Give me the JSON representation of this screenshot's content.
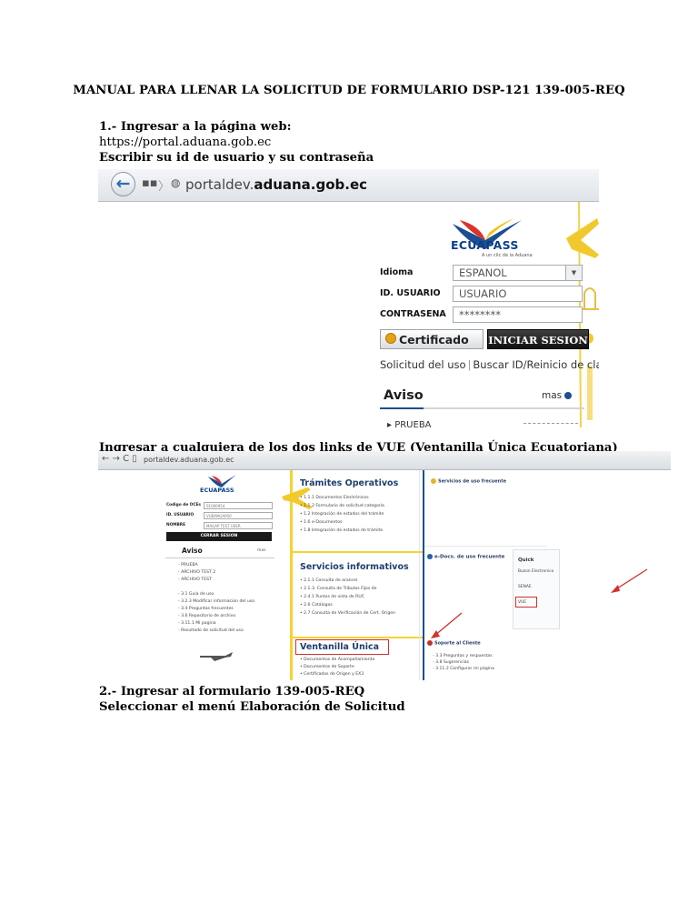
{
  "document": {
    "title": "MANUAL PARA LLENAR LA SOLICITUD DE FORMULARIO DSP-121 139-005-REQ",
    "step1_heading": "1.- Ingresar a la página web:",
    "step1_url": "https://portal.aduana.gob.ec",
    "step1_instruction": "Escribir su id de usuario y su contraseña",
    "vue_instruction": "Ingresar a cualquiera de los dos links de VUE (Ventanilla Única Ecuatoriana)",
    "step2_heading": "2.- Ingresar al formulario 139-005-REQ",
    "step2_instruction": "Seleccionar el menú Elaboración de Solicitud"
  },
  "login_screenshot": {
    "address_prefix": "portaldev.",
    "address_domain": "aduana.gob.ec",
    "logo_text": "ECUAPASS",
    "logo_tagline": "A un clic de la Aduana",
    "idioma_label": "Idioma",
    "idioma_value": "ESPANOL",
    "usuario_label": "ID. USUARIO",
    "usuario_value": "USUARIO",
    "contrasena_label": "CONTRASENA",
    "contrasena_value": "********",
    "certificado_button": "Certificado",
    "login_button": "INICIAR SESION",
    "link_solicitud": "Solicitud del uso",
    "link_buscar": "Buscar ID/Reinicio de clave",
    "aviso_title": "Aviso",
    "mas_label": "mas",
    "first_notice": "PRUEBA"
  },
  "dashboard_screenshot": {
    "address": "portaldev.aduana.gob.ec",
    "logo_text": "ECUAPASS",
    "codigo_label": "Codigo de OCEs",
    "codigo_value": "01000954",
    "usuario_label": "ID. USUARIO",
    "usuario_value": "VUEMAGAP00",
    "nombre_label": "NOMBRE",
    "nombre_value": "MAGAP TEST USER",
    "cerrar_button": "CERRAR SESION",
    "aviso_title": "Aviso",
    "mas_label": "mas",
    "aviso_items": [
      "PRUEBA",
      "ARCHIVO TEST 2",
      "ARCHIVO TEST"
    ],
    "help_items": [
      "3.1 Guia de uso",
      "3.2.3 Modificar informacion del uso",
      "3.4 Preguntas frecuentes",
      "3.6 Repositorio de archivo",
      "3.11.1 Mi pagina",
      "Resultado de solicitud del uso"
    ],
    "tramites_title": "Trámites Operativos",
    "tramites_items": [
      "1.1.1 Documentos Electrónicos",
      "1.1.2 Formulario de solicitud categoría",
      "1.2 Integración de estados del trámite",
      "1.6 e-Documentos",
      "1.8 Integración de estados de trámite"
    ],
    "servicios_title": "Servicios informativos",
    "servicios_items": [
      "2.1.1 Consulta de arancel",
      "2.1.3. Consulta de Tributos Fijos de",
      "2.4.1 Puntos de vista de RUC",
      "2.6 Catálogos",
      "2.7 Consulta de Verificación de Cert. Origen"
    ],
    "ventanilla_title": "Ventanilla Única",
    "ventanilla_items": [
      "Documentos de Acompañamiento",
      "Documentos de Soporte",
      "Certificados de Origen y EX3"
    ],
    "servicios_frecuente_title": "Servicios de uso frecuente",
    "edocs_title": "e-Docs. de uso frecuente",
    "soporte_title": "Soporte al Cliente",
    "soporte_items": [
      "3.3 Preguntas y respuestas",
      "3.8 Sugerencias",
      "3.11.2 Configurar mi página"
    ],
    "quick_title": "Quick",
    "quick_items": [
      "Buzon Electronico",
      "SENAE",
      "VUE"
    ]
  },
  "colors": {
    "accent_blue": "#1b4f92",
    "accent_yellow": "#f5d332",
    "highlight_red": "#d2312d"
  }
}
